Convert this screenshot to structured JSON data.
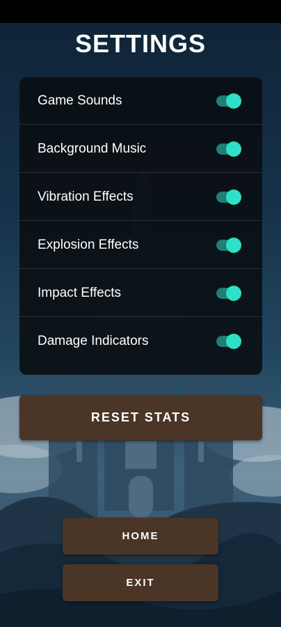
{
  "header": {
    "title": "SETTINGS"
  },
  "settings": {
    "items": [
      {
        "label": "Game Sounds",
        "enabled": true
      },
      {
        "label": "Background Music",
        "enabled": true
      },
      {
        "label": "Vibration Effects",
        "enabled": true
      },
      {
        "label": "Explosion Effects",
        "enabled": true
      },
      {
        "label": "Impact Effects",
        "enabled": true
      },
      {
        "label": "Damage Indicators",
        "enabled": true
      }
    ]
  },
  "buttons": {
    "reset": "RESET STATS",
    "home": "HOME",
    "exit": "EXIT"
  },
  "colors": {
    "accent": "#2ee0c8",
    "toggle_track": "#1f7f75",
    "button_bg": "#4b3526",
    "panel_bg": "#0a0e12"
  },
  "icons": {
    "background": "castle-illustration"
  }
}
